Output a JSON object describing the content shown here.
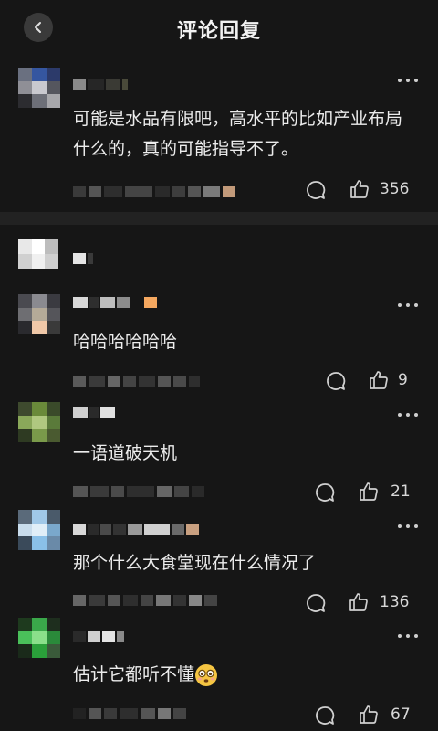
{
  "header": {
    "title": "评论回复"
  },
  "comments": [
    {
      "text": "可能是水品有限吧，高水平的比如产业布局什么的，真的可能指导不了。",
      "likes": "356"
    },
    {
      "text": "哈哈哈哈哈哈",
      "likes": "9"
    },
    {
      "text": "一语道破天机",
      "likes": "21"
    },
    {
      "text": "那个什么大食堂现在什么情况了",
      "likes": "136"
    },
    {
      "text": "估计它都听不懂",
      "likes": "67"
    }
  ],
  "icons": {
    "back": "chevron-left-icon",
    "more": "more-dots-icon",
    "reply": "comment-bubble-icon",
    "like": "thumbs-up-icon",
    "emoji": "flushed-face-emoji"
  },
  "colors": {
    "background": "#161616",
    "text": "#ececec",
    "accent_emoji": "#f5c542"
  }
}
